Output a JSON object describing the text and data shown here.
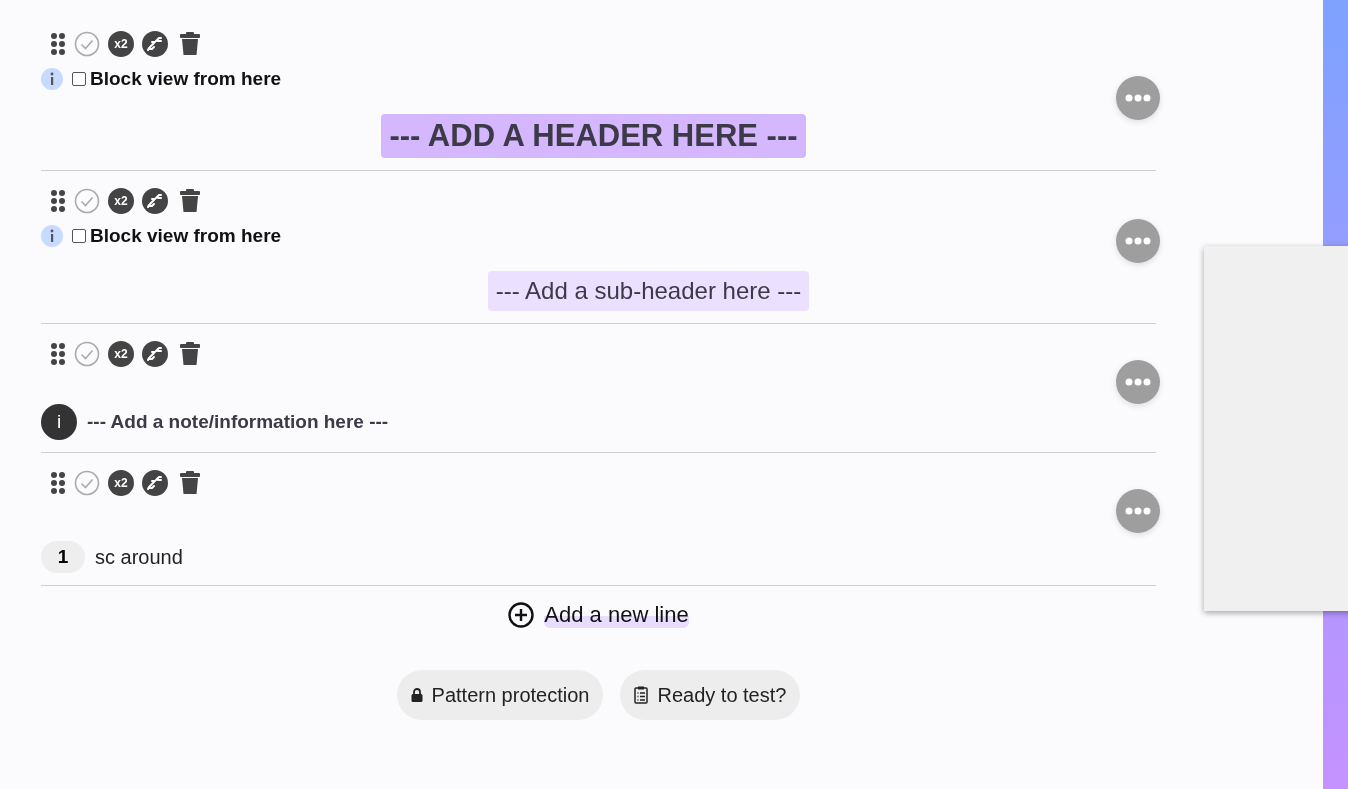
{
  "blocks": [
    {
      "kind": "header",
      "repeat_badge": "x2",
      "block_view": {
        "label": "Block view from here",
        "checked": false
      },
      "text": "--- ADD A HEADER HERE ---"
    },
    {
      "kind": "subheader",
      "repeat_badge": "x2",
      "block_view": {
        "label": "Block view from here",
        "checked": false
      },
      "text": "--- Add a sub-header here ---"
    },
    {
      "kind": "note",
      "repeat_badge": "x2",
      "badge": "i",
      "text": "--- Add a note/information here ---"
    },
    {
      "kind": "instruction",
      "repeat_badge": "x2",
      "badge": "1",
      "text": "sc around"
    }
  ],
  "add_line": "Add a new line",
  "buttons": [
    {
      "kind": "lock",
      "label": "Pattern protection"
    },
    {
      "kind": "clipboard",
      "label": "Ready to test?"
    }
  ]
}
